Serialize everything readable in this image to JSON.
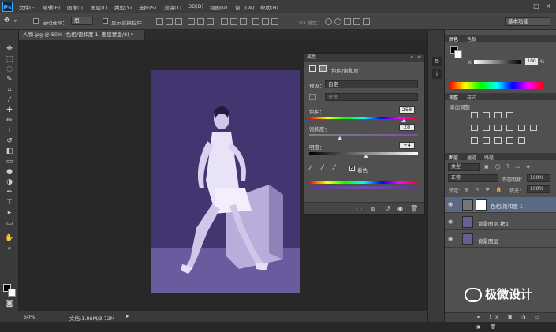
{
  "app": {
    "logo": "Ps"
  },
  "menu": [
    "文件(F)",
    "编辑(E)",
    "图像(I)",
    "图层(L)",
    "类型(Y)",
    "选择(S)",
    "滤镜(T)",
    "3D(D)",
    "视图(V)",
    "窗口(W)",
    "帮助(H)"
  ],
  "options": {
    "auto_select": "自动选择：",
    "auto_select_value": "组",
    "show_transform": "显示变换控件",
    "mode3d": "3D 模式：",
    "workspace": "基本功能"
  },
  "document": {
    "tab": "人物.jpg @ 50% (色相/饱和度 1, 图层蒙版/8) *",
    "zoom": "50%",
    "doc_info": "文档:1.86M/3.72M"
  },
  "properties": {
    "title": "属性",
    "adjustment_name": "色相/饱和度",
    "preset_label": "预设：",
    "preset_value": "自定",
    "channel_value": "全图",
    "hue_label": "色相：",
    "hue_value": "258",
    "saturation_label": "饱和度：",
    "saturation_value": "28",
    "lightness_label": "明度：",
    "lightness_value": "+4",
    "colorize_label": "着色",
    "hue_fraction": 0.87,
    "saturation_fraction": 0.28,
    "lightness_fraction": 0.52
  },
  "color_panel": {
    "tab_color": "颜色",
    "tab_swatches": "色板",
    "channel": "K",
    "value": "100",
    "unit": "%"
  },
  "adjustments_panel": {
    "tab_adjustments": "调整",
    "tab_styles": "样式",
    "add_label": "添加调整"
  },
  "layers_panel": {
    "tab_layers": "图层",
    "tab_channels": "通道",
    "tab_paths": "路径",
    "kind": "类型",
    "blend_mode": "正常",
    "opacity_label": "不透明度：",
    "opacity_value": "100%",
    "lock_label": "锁定：",
    "fill_label": "填充：",
    "fill_value": "100%",
    "layers": [
      {
        "name": "色相/饱和度 1",
        "selected": true
      },
      {
        "name": "背景图层 拷贝",
        "selected": false
      },
      {
        "name": "背景图层",
        "selected": false
      }
    ]
  },
  "watermark": "极微设计",
  "colors": {
    "accent": "#46a6ee",
    "photo_tint": "#4a3a78",
    "selected_layer": "#5a6a84"
  }
}
